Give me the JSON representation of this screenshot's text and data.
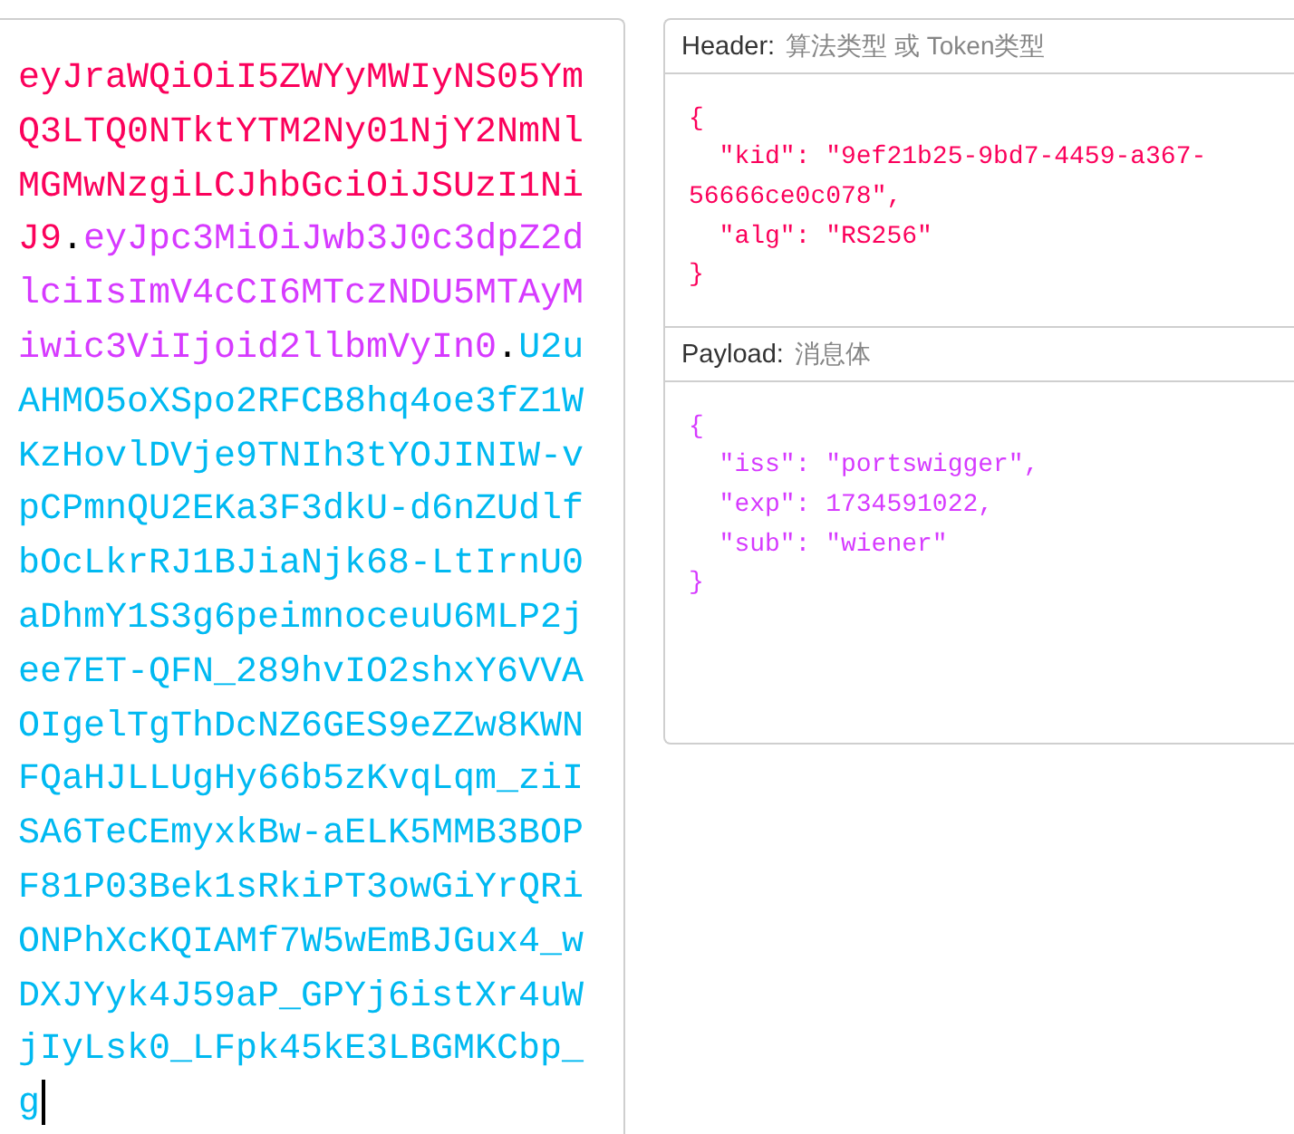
{
  "encoded": {
    "focused": true,
    "parts": [
      {
        "text": "eyJraWQiOiI5ZWYyMWIyNS05YmQ3LTQ0NTktYTM2Ny01NjY2NmNlMGMwNzgiLCJhbGciOiJSUzI1NiJ9",
        "color": "#fb015b"
      },
      {
        "text": ".",
        "color": "#000000"
      },
      {
        "text": "eyJpc3MiOiJwb3J0c3dpZ2dlciIsImV4cCI6MTczNDU5MTAyMiwic3ViIjoid2llbmVyIn0",
        "color": "#d63aff"
      },
      {
        "text": ".",
        "color": "#000000"
      },
      {
        "text": "U2uAHMO5oXSpo2RFCB8hq4oe3fZ1WKzHovlDVje9TNIh3tYOJINIW-vpCPmnQU2EKa3F3dkU-d6nZUdlfbOcLkrRJ1BJiaNjk68-LtIrnU0aDhmY1S3g6peimnoceuU6MLP2jee7ET-QFN_289hvIO2shxY6VVAOIgelTgThDcNZ6GES9eZZw8KWNFQaHJLLUgHy66b5zKvqLqm_ziISA6TeCEmyxkBw-aELK5MMB3BOPF81P03Bek1sRkiPT3owGiYrQRiONPhXcKQIAMf7W5wEmBJGux4_wDXJYyk4J59aP_GPYj6istXr4uWjIyLsk0_LFpk45kE3LBGMKCbp_g",
        "color": "#00b9f1"
      }
    ]
  },
  "decoded": [
    {
      "label": "Header:",
      "description": "算法类型 或 Token类型",
      "color": "#fb015b",
      "code": {
        "open": "{",
        "entries": [
          "\"kid\": \"9ef21b25-9bd7-4459-a367-56666ce0c078\",",
          "\"alg\": \"RS256\""
        ],
        "close": "}"
      }
    },
    {
      "label": "Payload:",
      "description": "消息体",
      "color": "#d63aff",
      "code": {
        "open": "{",
        "entries": [
          "\"iss\": \"portswigger\",",
          "\"exp\": 1734591022,",
          "\"sub\": \"wiener\""
        ],
        "close": "}"
      }
    }
  ]
}
